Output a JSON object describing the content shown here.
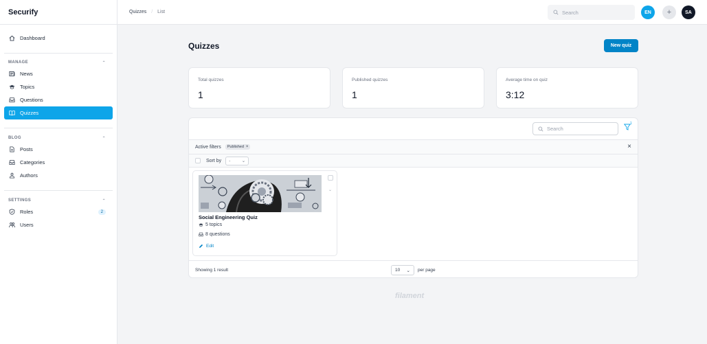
{
  "app": {
    "name": "Securify"
  },
  "sidebar": {
    "dashboard": "Dashboard",
    "groups": [
      {
        "title": "MANAGE",
        "items": [
          {
            "label": "News",
            "icon": "newspaper-icon"
          },
          {
            "label": "Topics",
            "icon": "graduation-cap-icon"
          },
          {
            "label": "Questions",
            "icon": "inbox-icon"
          },
          {
            "label": "Quizzes",
            "icon": "book-open-icon",
            "active": true
          }
        ]
      },
      {
        "title": "BLOG",
        "items": [
          {
            "label": "Posts",
            "icon": "document-icon"
          },
          {
            "label": "Categories",
            "icon": "inbox-icon"
          },
          {
            "label": "Authors",
            "icon": "user-group-icon"
          }
        ]
      },
      {
        "title": "SETTINGS",
        "items": [
          {
            "label": "Roles",
            "icon": "shield-check-icon",
            "badge": "2"
          },
          {
            "label": "Users",
            "icon": "users-icon"
          }
        ]
      }
    ]
  },
  "topbar": {
    "breadcrumbs": [
      "Quizzes",
      "List"
    ],
    "search_placeholder": "Search",
    "language": "EN",
    "plus": "+",
    "avatar": "SA"
  },
  "page": {
    "title": "Quizzes",
    "new_button": "New quiz"
  },
  "stats": [
    {
      "label": "Total quizzes",
      "value": "1"
    },
    {
      "label": "Published quizzes",
      "value": "1"
    },
    {
      "label": "Average time on quiz",
      "value": "3:12"
    }
  ],
  "table": {
    "search_placeholder": "Search",
    "filter_badge": "1",
    "active_filters_label": "Active filters",
    "filter_chip": "Published",
    "sort_label": "Sort by",
    "sort_value": "-",
    "records": [
      {
        "title": "Social Engineering Quiz",
        "topics": "5 topics",
        "questions": "8 questions",
        "edit": "Edit"
      }
    ],
    "showing": "Showing 1 result",
    "per_page_value": "10",
    "per_page_label": "per page"
  },
  "footer": {
    "brand": "filament"
  },
  "colors": {
    "primary": "#0ea5e9",
    "primary_dark": "#0284c7",
    "background": "#f3f4f6"
  }
}
